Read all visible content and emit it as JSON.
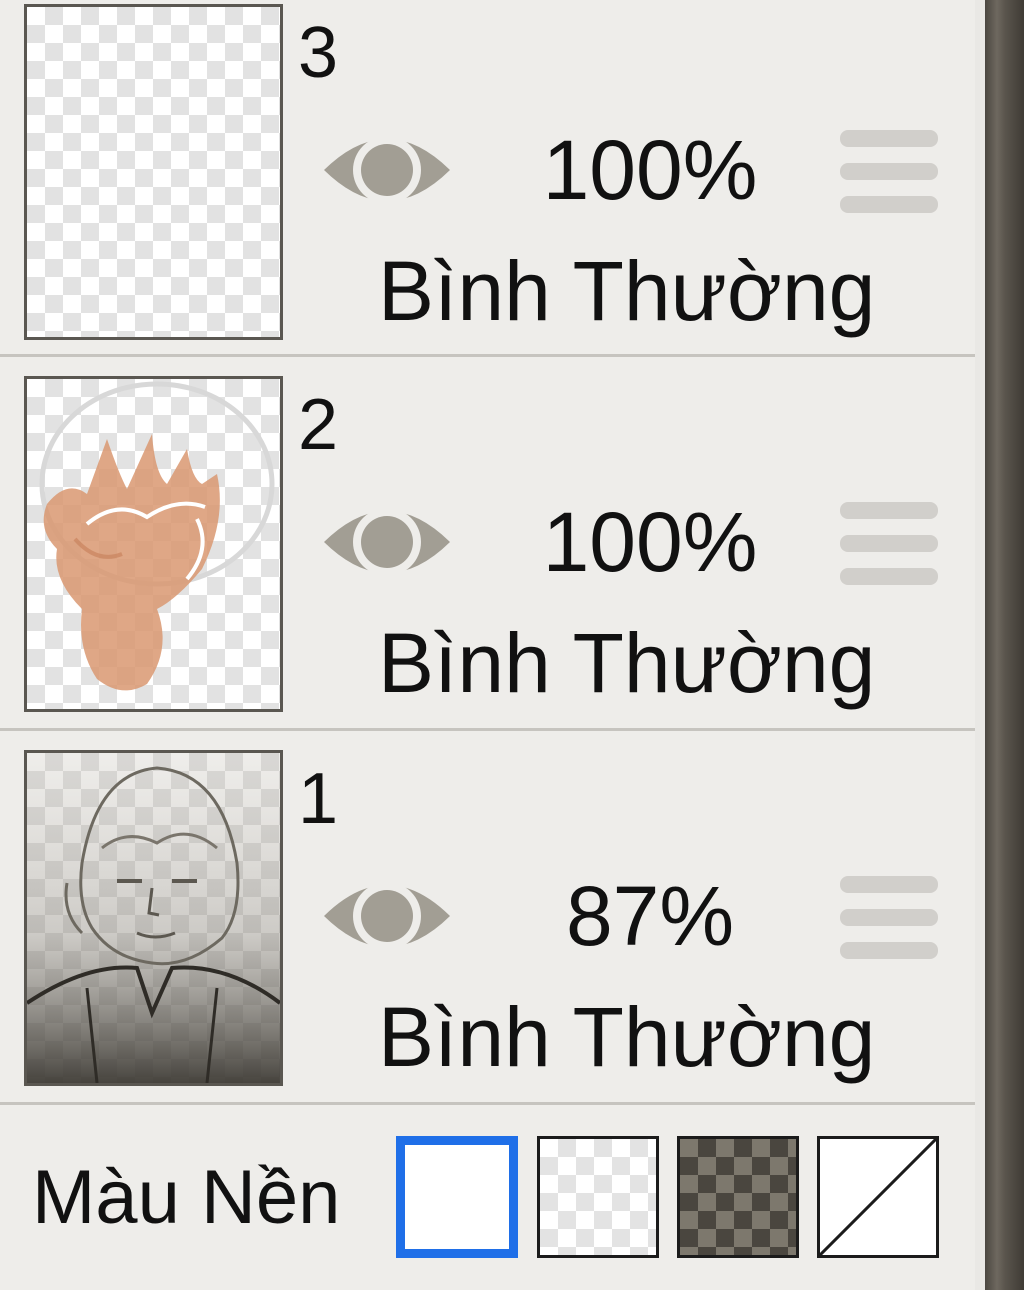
{
  "layers": [
    {
      "number": "3",
      "opacity": "100%",
      "blend_mode": "Bình Thường",
      "visible": true
    },
    {
      "number": "2",
      "opacity": "100%",
      "blend_mode": "Bình Thường",
      "visible": true
    },
    {
      "number": "1",
      "opacity": "87%",
      "blend_mode": "Bình Thường",
      "visible": true
    }
  ],
  "background": {
    "label": "Màu Nền",
    "options": [
      {
        "name": "white",
        "selected": true
      },
      {
        "name": "transparent-light",
        "selected": false
      },
      {
        "name": "transparent-dark",
        "selected": false
      },
      {
        "name": "none",
        "selected": false
      }
    ]
  },
  "colors": {
    "panel": "#eeedea",
    "selection": "#1f6fe8",
    "icon": "#a29e94",
    "drag_handle": "#d1cfcb"
  }
}
